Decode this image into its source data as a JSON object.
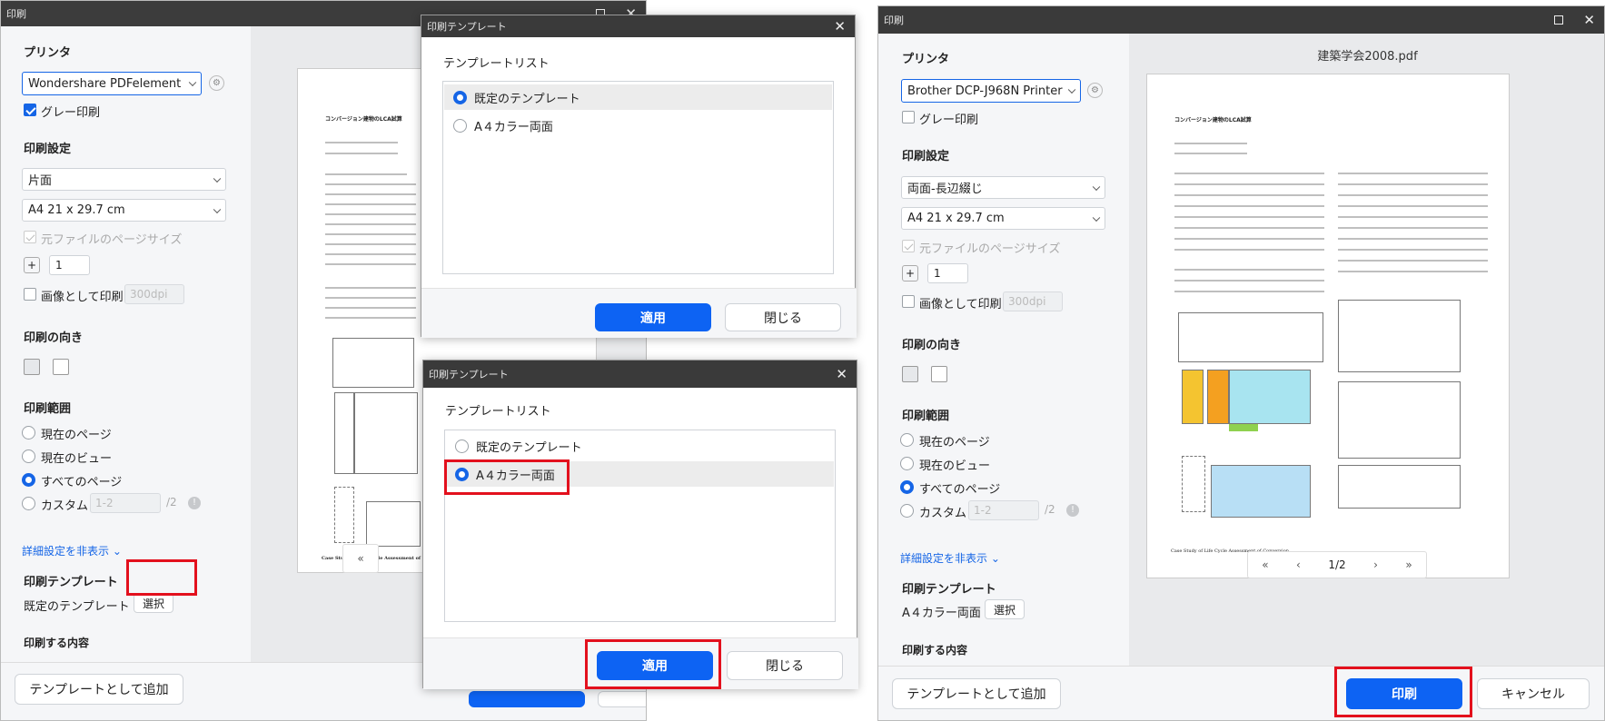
{
  "window1": {
    "title": "印刷",
    "printer_heading": "プリンタ",
    "printer_value": "Wondershare PDFelement",
    "grayscale_label": "グレー印刷",
    "print_settings_heading": "印刷設定",
    "duplex_value": "片面",
    "paper_value": "A4 21 x 29.7 cm",
    "original_size_label": "元ファイルのページサイズ",
    "copies": "1",
    "print_as_image_label": "画像として印刷",
    "dpi_value": "300dpi",
    "orientation_heading": "印刷の向き",
    "range_heading": "印刷範囲",
    "range_current_page": "現在のページ",
    "range_current_view": "現在のビュー",
    "range_all_pages": "すべてのページ",
    "range_custom": "カスタム",
    "custom_placeholder": "1-2",
    "custom_total": "/2",
    "advanced_link": "詳細設定を非表示",
    "template_heading": "印刷テンプレート",
    "template_value": "既定のテンプレート",
    "select_button": "選択",
    "cut_heading": "印刷する内容",
    "add_template_button": "テンプレートとして追加",
    "preview_paper_title": "コンバージョン建物のLCA試算",
    "preview_footer": "Case Study of Life Cycle Assessment of",
    "pager_first": "«"
  },
  "dialog1": {
    "title": "印刷テンプレート",
    "list_heading": "テンプレートリスト",
    "items": [
      "既定のテンプレート",
      "A４カラー両面"
    ],
    "apply_button": "適用",
    "close_button": "閉じる"
  },
  "dialog2": {
    "title": "印刷テンプレート",
    "list_heading": "テンプレートリスト",
    "items": [
      "既定のテンプレート",
      "A４カラー両面"
    ],
    "apply_button": "適用",
    "close_button": "閉じる"
  },
  "window2": {
    "title": "印刷",
    "printer_heading": "プリンタ",
    "printer_value": "Brother DCP-J968N Printer",
    "grayscale_label": "グレー印刷",
    "print_settings_heading": "印刷設定",
    "duplex_value": "両面-長辺綴じ",
    "paper_value": "A4 21 x 29.7 cm",
    "original_size_label": "元ファイルのページサイズ",
    "copies": "1",
    "print_as_image_label": "画像として印刷",
    "dpi_value": "300dpi",
    "orientation_heading": "印刷の向き",
    "range_heading": "印刷範囲",
    "range_current_page": "現在のページ",
    "range_current_view": "現在のビュー",
    "range_all_pages": "すべてのページ",
    "range_custom": "カスタム",
    "custom_placeholder": "1-2",
    "custom_total": "/2",
    "advanced_link": "詳細設定を非表示",
    "template_heading": "印刷テンプレート",
    "template_value": "A４カラー両面",
    "select_button": "選択",
    "cut_heading": "印刷する内容",
    "add_template_button": "テンプレートとして追加",
    "print_button": "印刷",
    "cancel_button": "キャンセル",
    "file_name": "建築学会2008.pdf",
    "preview_paper_title": "コンバージョン建物のLCA試算",
    "preview_footer": "Case Study of Life Cycle Assessment of Conversion",
    "pager": {
      "first": "«",
      "prev": "‹",
      "page": "1",
      "total": "/2",
      "next": "›",
      "last": "»"
    }
  },
  "colors": {
    "accent": "#0d63f3",
    "highlight_box": "#e3101d",
    "titlebar": "#3a3a3a"
  }
}
